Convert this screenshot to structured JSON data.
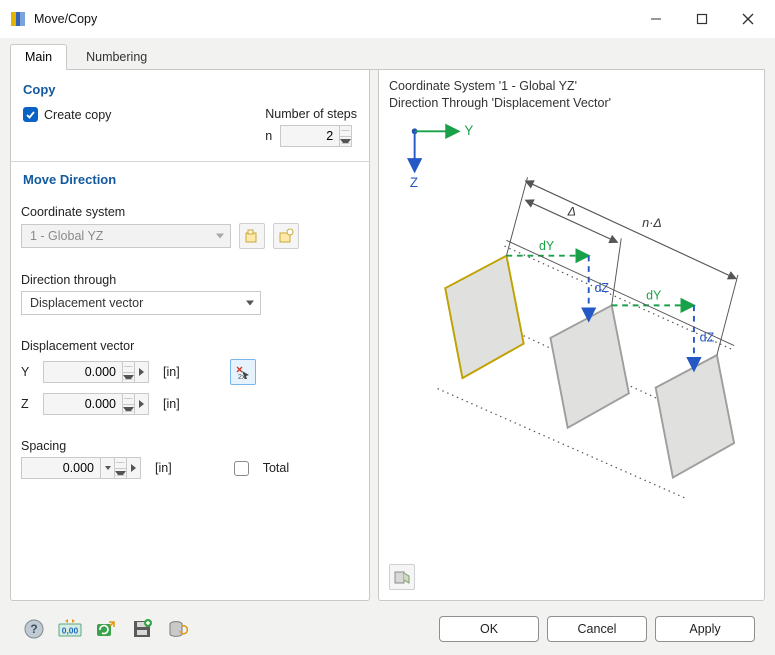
{
  "window": {
    "title": "Move/Copy"
  },
  "tabs": {
    "main": "Main",
    "numbering": "Numbering",
    "active": "main"
  },
  "copy": {
    "heading": "Copy",
    "create_copy_label": "Create copy",
    "create_copy_checked": true,
    "steps_label": "Number of steps",
    "steps_letter": "n",
    "steps_value": "2"
  },
  "move": {
    "heading": "Move Direction",
    "coord_label": "Coordinate system",
    "coord_value": "1 - Global YZ",
    "dir_label": "Direction through",
    "dir_value": "Displacement vector",
    "vec_label": "Displacement vector",
    "y_label": "Y",
    "y_value": "0.000",
    "z_label": "Z",
    "z_value": "0.000",
    "unit": "[in]",
    "spacing_label": "Spacing",
    "spacing_value": "0.000",
    "total_label": "Total",
    "total_checked": false
  },
  "preview": {
    "line1": "Coordinate System '1 - Global YZ'",
    "line2": "Direction Through 'Displacement Vector'",
    "axis_y": "Y",
    "axis_z": "Z",
    "dy": "dY",
    "dz": "dZ",
    "delta": "Δ",
    "ndelta": "n·Δ"
  },
  "buttons": {
    "ok": "OK",
    "cancel": "Cancel",
    "apply": "Apply"
  },
  "icons": {
    "help": "help-icon",
    "decimals": "decimal-places-icon",
    "reset": "reset-icon",
    "save": "save-icon",
    "db": "database-icon",
    "coord_edit": "coord-edit-icon",
    "coord_new": "coord-new-icon",
    "pick": "pick-point-icon",
    "toggle": "diagram-toggle-icon"
  },
  "colors": {
    "accent": "#0a62c4",
    "heading": "#135a9e",
    "axis_green": "#18a148",
    "axis_blue": "#2558c7",
    "shape_stroke": "#bfa100",
    "shape_fill": "#e0e0de"
  }
}
